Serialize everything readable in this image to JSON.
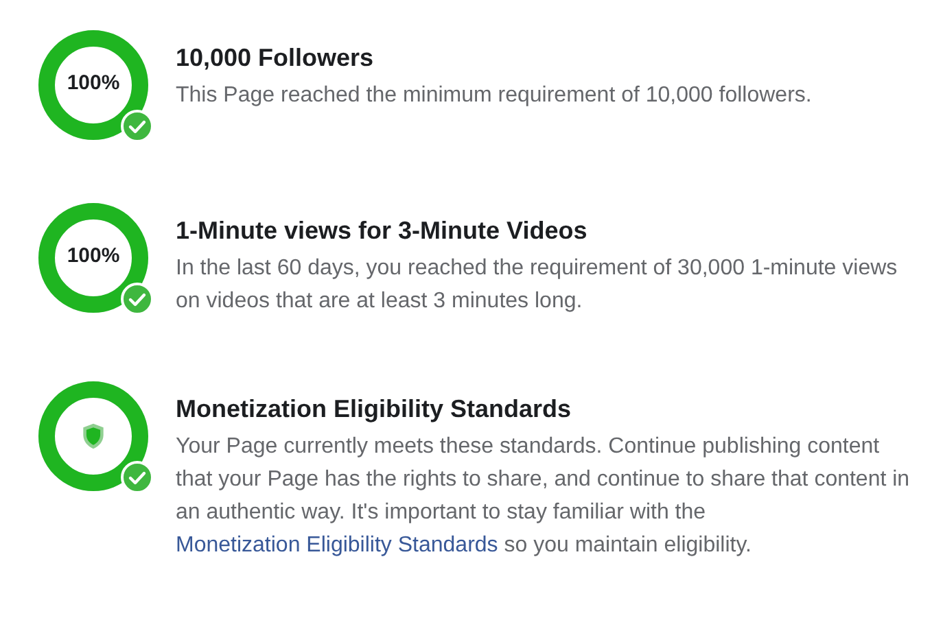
{
  "requirements": [
    {
      "kind": "percent",
      "level": 1,
      "percent": "100%",
      "complete": true,
      "title": "10,000 Followers",
      "description": [
        {
          "kind": "text",
          "text": "This Page reached the minimum requirement of 10,000 followers."
        }
      ]
    },
    {
      "kind": "percent",
      "level": 1,
      "percent": "100%",
      "complete": true,
      "title": "1-Minute views for 3-Minute Videos",
      "description": [
        {
          "kind": "text",
          "text": "In the last 60 days, you reached the requirement of 30,000 1-minute views on videos that are at least 3 minutes long."
        }
      ]
    },
    {
      "kind": "shield",
      "level": 1,
      "complete": true,
      "title": "Monetization Eligibility Standards",
      "description": [
        {
          "kind": "text",
          "text": "Your Page currently meets these standards. Continue publishing content that your Page has the rights to share, and continue to share that content in an authentic way. It's important to stay familiar with the "
        },
        {
          "kind": "link",
          "text": "Monetization Eligibility Standards"
        },
        {
          "kind": "text",
          "text": " so you maintain eligibility."
        }
      ]
    }
  ]
}
